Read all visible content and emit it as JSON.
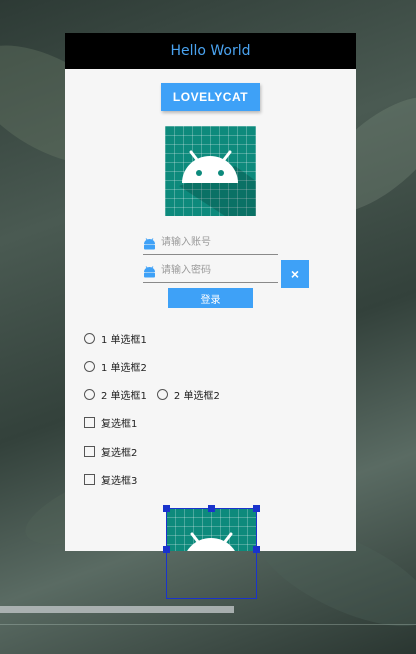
{
  "app": {
    "title": "Hello World"
  },
  "buttons": {
    "lovelycat": "LOVELYCAT",
    "login": "登录",
    "clear": "×"
  },
  "fields": {
    "account_placeholder": "请输入账号",
    "password_placeholder": "请输入密码"
  },
  "radios": {
    "group1": [
      "1 单选框1",
      "1 单选框2"
    ],
    "group2": [
      "2 单选框1",
      "2 单选框2"
    ]
  },
  "checkboxes": [
    "复选框1",
    "复选框2",
    "复选框3"
  ],
  "colors": {
    "accent": "#3ea1f7",
    "titlebar": "#000000",
    "title_text": "#4aa3f0",
    "logo_bg": "#0d8a7c",
    "selection": "#1a33cc"
  },
  "icons": {
    "logo": "android-logo-icon",
    "field_icon": "android-icon"
  }
}
